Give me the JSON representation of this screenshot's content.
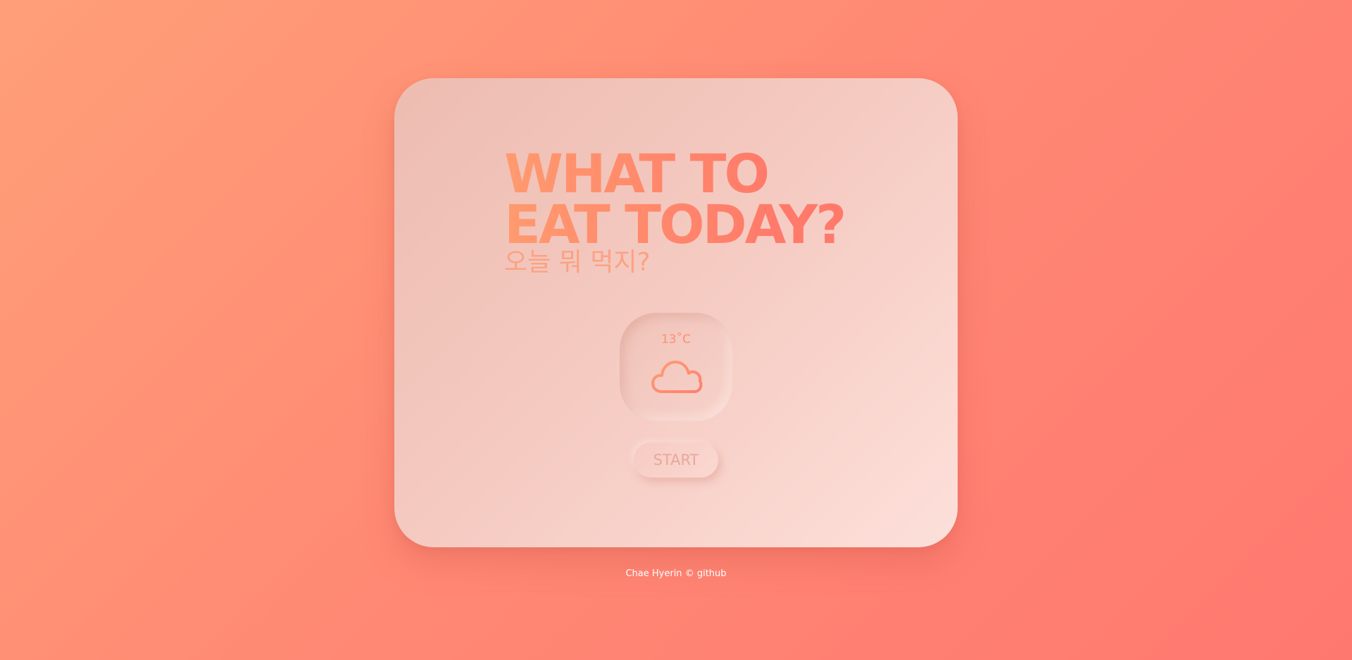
{
  "colors": {
    "background_start": "#ff9f78",
    "background_end": "#ff7870",
    "card": "#f5cbc2",
    "title_accent": "#ff7a6a",
    "icon_accent": "#ff8f72",
    "footer_text": "#ffffff"
  },
  "card": {
    "title_line1": "WHAT TO",
    "title_line2": "EAT TODAY?",
    "subtitle": "오늘 뭐 먹지?"
  },
  "weather": {
    "temperature": "13˚C",
    "icon": "cloud-icon"
  },
  "start_button": {
    "label": "START"
  },
  "footer": {
    "author": "Chae Hyerin",
    "copyright_symbol": "©",
    "link_label": "github"
  }
}
